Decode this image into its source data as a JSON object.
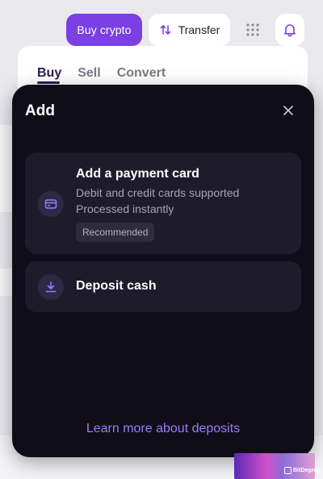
{
  "topbar": {
    "buy_label": "Buy crypto",
    "transfer_label": "Transfer",
    "transfer_icon": "arrows-up-down-icon",
    "apps_icon": "grid-dots-icon",
    "bell_icon": "bell-icon"
  },
  "background": {
    "tabs": [
      "Buy",
      "Sell",
      "Convert"
    ],
    "active_tab": "Buy"
  },
  "modal": {
    "title": "Add",
    "close_icon": "close-icon",
    "options": [
      {
        "title": "Add a payment card",
        "description_lines": [
          "Debit and credit cards supported",
          "Processed instantly"
        ],
        "badge": "Recommended",
        "icon": "credit-card-icon"
      },
      {
        "title": "Deposit cash",
        "icon": "download-arrow-icon"
      }
    ],
    "learn_more": "Learn more about deposits"
  },
  "watermark": {
    "text": "BitDegree"
  },
  "colors": {
    "accent": "#7b3fe4",
    "modal_bg": "#0f0e18",
    "option_bg": "#1e1c2b",
    "link": "#9d7bff"
  }
}
